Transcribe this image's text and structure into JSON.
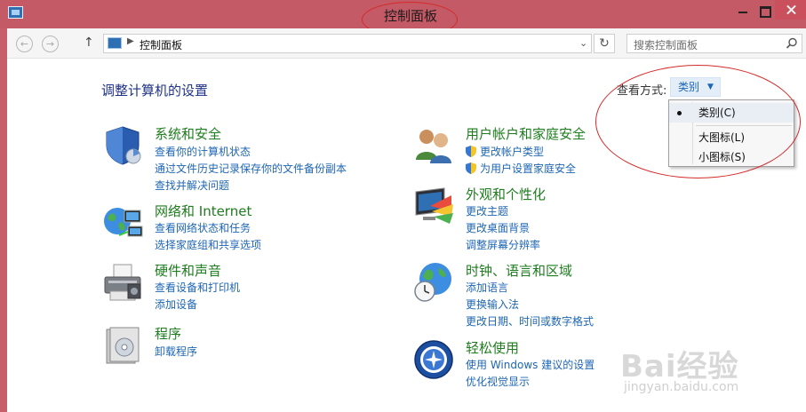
{
  "window": {
    "title": "控制面板"
  },
  "nav": {
    "breadcrumb": "控制面板",
    "search_placeholder": "搜索控制面板"
  },
  "main": {
    "title": "调整计算机的设置",
    "view_label": "查看方式:",
    "view_value": "类别"
  },
  "view_menu": {
    "options": [
      "类别(C)",
      "大图标(L)",
      "小图标(S)"
    ],
    "selected_index": 0
  },
  "categories": {
    "left": [
      {
        "title": "系统和安全",
        "icon": "shield-icon",
        "links": [
          "查看你的计算机状态",
          "通过文件历史记录保存你的文件备份副本",
          "查找并解决问题"
        ]
      },
      {
        "title": "网络和 Internet",
        "icon": "globe-network-icon",
        "links": [
          "查看网络状态和任务",
          "选择家庭组和共享选项"
        ]
      },
      {
        "title": "硬件和声音",
        "icon": "printer-icon",
        "links": [
          "查看设备和打印机",
          "添加设备"
        ]
      },
      {
        "title": "程序",
        "icon": "programs-icon",
        "links": [
          "卸载程序"
        ]
      }
    ],
    "right": [
      {
        "title": "用户帐户和家庭安全",
        "icon": "users-icon",
        "links": [
          "更改帐户类型",
          "为用户设置家庭安全"
        ]
      },
      {
        "title": "外观和个性化",
        "icon": "monitor-palette-icon",
        "links": [
          "更改主题",
          "更改桌面背景",
          "调整屏幕分辨率"
        ]
      },
      {
        "title": "时钟、语言和区域",
        "icon": "clock-globe-icon",
        "links": [
          "添加语言",
          "更换输入法",
          "更改日期、时间或数字格式"
        ]
      },
      {
        "title": "轻松使用",
        "icon": "ease-of-access-icon",
        "links": [
          "使用 Windows 建议的设置",
          "优化视觉显示"
        ]
      }
    ]
  },
  "watermark": {
    "brand": "Bai经验",
    "url": "jingyan.baidu.com"
  }
}
